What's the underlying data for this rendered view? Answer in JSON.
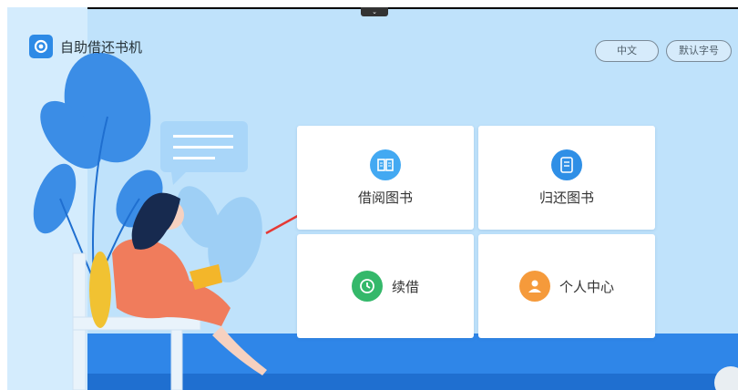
{
  "app": {
    "title": "自助借还书机",
    "collapse_glyph": "⌄"
  },
  "header": {
    "language_label": "中文",
    "font_size_label": "默认字号"
  },
  "menu": {
    "borrow_label": "借阅图书",
    "return_label": "归还图书",
    "renew_label": "续借",
    "personal_label": "个人中心"
  },
  "icons": {
    "logo": "logo-icon",
    "borrow": "book-icon",
    "return": "document-icon",
    "renew": "clock-icon",
    "personal": "user-icon"
  },
  "colors": {
    "background": "#bfe2fb",
    "accent": "#2d8ae6",
    "borrow_icon": "#43a9f2",
    "return_icon": "#2f8fe6",
    "renew_icon": "#34b86a",
    "personal_icon": "#f59a3b",
    "arrow": "#e53935"
  }
}
